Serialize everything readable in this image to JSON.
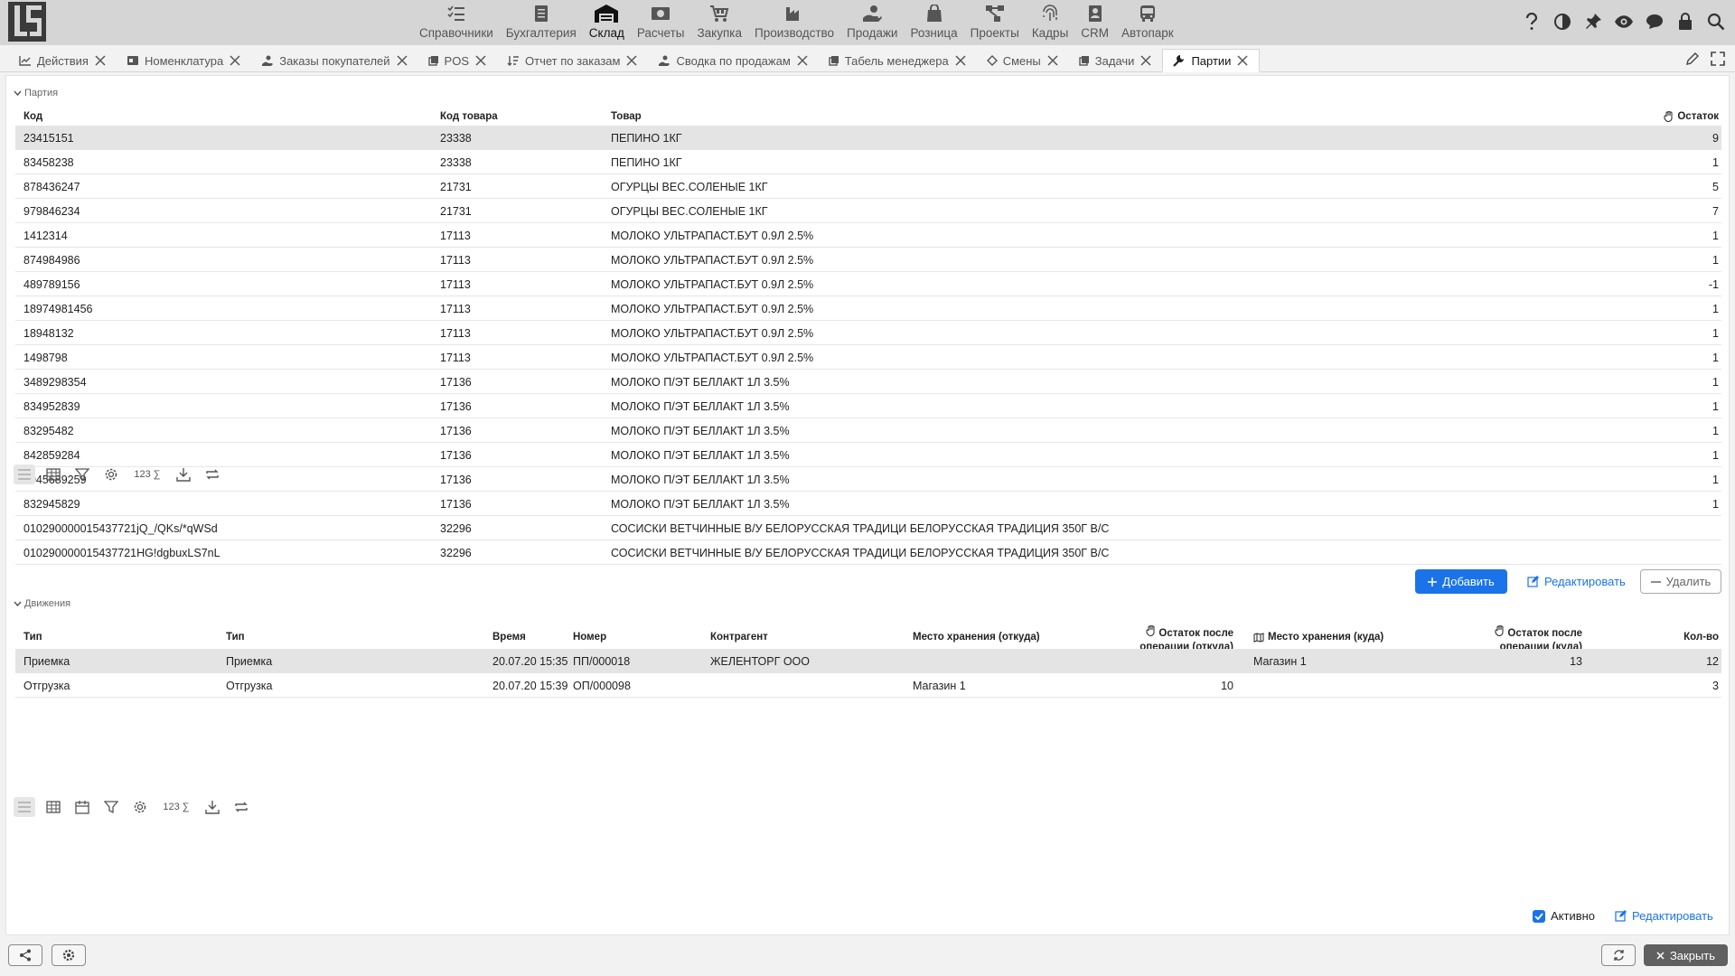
{
  "topbar": {
    "modules": [
      {
        "label": "Справочники",
        "icon": "list-check-icon"
      },
      {
        "label": "Бухгалтерия",
        "icon": "ledger-icon"
      },
      {
        "label": "Склад",
        "icon": "warehouse-icon"
      },
      {
        "label": "Расчеты",
        "icon": "money-icon"
      },
      {
        "label": "Закупка",
        "icon": "cart-icon"
      },
      {
        "label": "Производство",
        "icon": "factory-icon"
      },
      {
        "label": "Продажи",
        "icon": "hand-coin-icon"
      },
      {
        "label": "Розница",
        "icon": "shopping-bag-icon"
      },
      {
        "label": "Проекты",
        "icon": "project-tree-icon"
      },
      {
        "label": "Кадры",
        "icon": "fingerprint-icon"
      },
      {
        "label": "CRM",
        "icon": "contact-card-icon"
      },
      {
        "label": "Автопарк",
        "icon": "bus-icon"
      }
    ],
    "active_module": "Склад"
  },
  "tabs": [
    {
      "label": "Действия",
      "icon": "chart-line-icon"
    },
    {
      "label": "Номенклатура",
      "icon": "id-card-icon"
    },
    {
      "label": "Заказы покупателей",
      "icon": "hand-coin-icon"
    },
    {
      "label": "POS",
      "icon": "copy-icon"
    },
    {
      "label": "Отчет по заказам",
      "icon": "sort-icon"
    },
    {
      "label": "Сводка по продажам",
      "icon": "hand-coin-icon"
    },
    {
      "label": "Табель менеджера",
      "icon": "copy-icon"
    },
    {
      "label": "Смены",
      "icon": "shift-icon"
    },
    {
      "label": "Задачи",
      "icon": "copy-icon"
    },
    {
      "label": "Партии",
      "icon": "wrench-icon"
    }
  ],
  "active_tab": "Партии",
  "batches": {
    "section_title": "Партия",
    "columns": {
      "code": "Код",
      "product_code": "Код товара",
      "product": "Товар",
      "balance": "Остаток"
    },
    "rows": [
      {
        "code": "23415151",
        "product_code": "23338",
        "product": "ПЕПИНО 1КГ",
        "balance": "9"
      },
      {
        "code": "83458238",
        "product_code": "23338",
        "product": "ПЕПИНО 1КГ",
        "balance": "1"
      },
      {
        "code": "878436247",
        "product_code": "21731",
        "product": "ОГУРЦЫ ВЕС.СОЛЕНЫЕ 1КГ",
        "balance": "5"
      },
      {
        "code": "979846234",
        "product_code": "21731",
        "product": "ОГУРЦЫ ВЕС.СОЛЕНЫЕ 1КГ",
        "balance": "7"
      },
      {
        "code": "1412314",
        "product_code": "17113",
        "product": "МОЛОКО УЛЬТРАПАСТ.БУТ 0.9Л 2.5%",
        "balance": "1"
      },
      {
        "code": "874984986",
        "product_code": "17113",
        "product": "МОЛОКО УЛЬТРАПАСТ.БУТ 0.9Л 2.5%",
        "balance": "1"
      },
      {
        "code": "489789156",
        "product_code": "17113",
        "product": "МОЛОКО УЛЬТРАПАСТ.БУТ 0.9Л 2.5%",
        "balance": "-1"
      },
      {
        "code": "18974981456",
        "product_code": "17113",
        "product": "МОЛОКО УЛЬТРАПАСТ.БУТ 0.9Л 2.5%",
        "balance": "1"
      },
      {
        "code": "18948132",
        "product_code": "17113",
        "product": "МОЛОКО УЛЬТРАПАСТ.БУТ 0.9Л 2.5%",
        "balance": "1"
      },
      {
        "code": "1498798",
        "product_code": "17113",
        "product": "МОЛОКО УЛЬТРАПАСТ.БУТ 0.9Л 2.5%",
        "balance": "1"
      },
      {
        "code": "3489298354",
        "product_code": "17136",
        "product": "МОЛОКО П/ЭТ БЕЛЛАКТ 1Л 3.5%",
        "balance": "1"
      },
      {
        "code": "834952839",
        "product_code": "17136",
        "product": "МОЛОКО П/ЭТ БЕЛЛАКТ 1Л 3.5%",
        "balance": "1"
      },
      {
        "code": "83295482",
        "product_code": "17136",
        "product": "МОЛОКО П/ЭТ БЕЛЛАКТ 1Л 3.5%",
        "balance": "1"
      },
      {
        "code": "842859284",
        "product_code": "17136",
        "product": "МОЛОКО П/ЭТ БЕЛЛАКТ 1Л 3.5%",
        "balance": "1"
      },
      {
        "code": "8945689259",
        "product_code": "17136",
        "product": "МОЛОКО П/ЭТ БЕЛЛАКТ 1Л 3.5%",
        "balance": "1"
      },
      {
        "code": "832945829",
        "product_code": "17136",
        "product": "МОЛОКО П/ЭТ БЕЛЛАКТ 1Л 3.5%",
        "balance": "1"
      },
      {
        "code": "010290000015437721jQ_/QKs/*qWSd",
        "product_code": "32296",
        "product": "СОСИСКИ ВЕТЧИННЫЕ В/У БЕЛОРУССКАЯ ТРАДИЦИ БЕЛОРУССКАЯ ТРАДИЦИЯ 350Г В/С",
        "balance": ""
      },
      {
        "code": "010290000015437721HG!dgbuxLS7nL",
        "product_code": "32296",
        "product": "СОСИСКИ ВЕТЧИННЫЕ В/У БЕЛОРУССКАЯ ТРАДИЦИ БЕЛОРУССКАЯ ТРАДИЦИЯ 350Г В/С",
        "balance": ""
      }
    ],
    "toolbar_counter": "123",
    "add_label": "Добавить",
    "edit_label": "Редактировать",
    "delete_label": "Удалить"
  },
  "movements": {
    "section_title": "Движения",
    "columns": {
      "type1": "Тип",
      "type2": "Тип",
      "time": "Время",
      "number": "Номер",
      "counterparty": "Контрагент",
      "from_storage": "Место хранения (откуда)",
      "balance_from_l1": "Остаток после",
      "balance_from_l2": "операции (откуда)",
      "to_storage": "Место хранения (куда)",
      "balance_to_l1": "Остаток после",
      "balance_to_l2": "операции (куда)",
      "qty": "Кол-во"
    },
    "rows": [
      {
        "type1": "Приемка",
        "type2": "Приемка",
        "time": "20.07.20 15:35",
        "number": "ПП/000018",
        "counterparty": "ЖЕЛЕНТОРГ ООО",
        "from_storage": "",
        "balance_from": "",
        "to_storage": "Магазин 1",
        "balance_to": "13",
        "qty": "12"
      },
      {
        "type1": "Отгрузка",
        "type2": "Отгрузка",
        "time": "20.07.20 15:39",
        "number": "ОП/000098",
        "counterparty": "",
        "from_storage": "Магазин 1",
        "balance_from": "10",
        "to_storage": "",
        "balance_to": "",
        "qty": "3"
      }
    ],
    "toolbar_counter": "123",
    "active_label": "Активно",
    "active_checked": true,
    "edit_label": "Редактировать"
  },
  "footer": {
    "close_label": "Закрыть"
  },
  "colors": {
    "accent": "#1a73e8",
    "topbar": "#d5d5d5",
    "selected_row": "#e4e4e4"
  }
}
